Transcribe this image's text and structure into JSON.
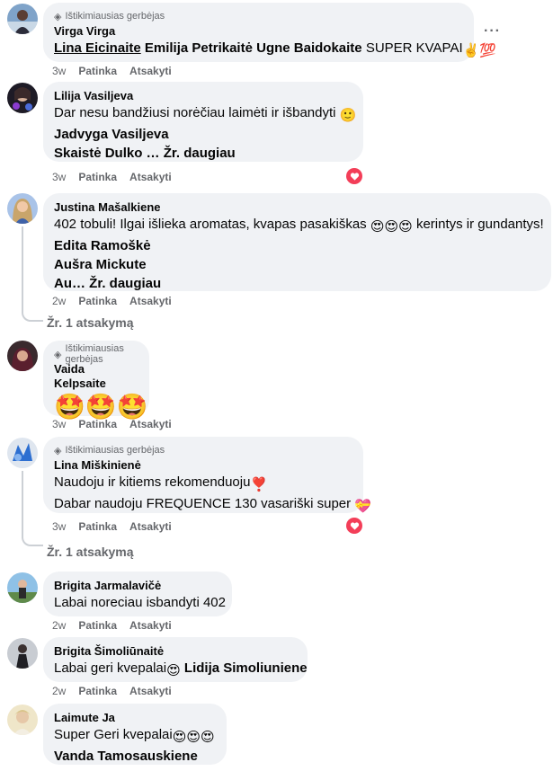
{
  "fan_badge": "Ištikimiausias gerbėjas",
  "action_like": "Patinka",
  "action_reply": "Atsakyti",
  "comments": [
    {
      "author": "Virga Virga",
      "time": "3w",
      "line1_tag1": "Lina Eicinaite",
      "line1_tag2": "Emilija Petrikaitė",
      "line1_tag3": "Ugne Baidokaite",
      "line1_text": "SUPER KVAPAI",
      "line1_emoji": "✌️💯"
    },
    {
      "author": "Lilija Vasiljeva",
      "time": "3w",
      "line1": "Dar nesu bandžiusi norėčiau laimėti ir išbandyti",
      "line1_emoji": "🙂",
      "line2_tag": "Jadvyga Vasiljeva",
      "line3_tag": "Skaistė Dulko",
      "line3_more": "… Žr. daugiau"
    },
    {
      "author": "Justina Mašalkiene",
      "time": "2w",
      "line1": "402 tobuli! Ilgai išlieka aromatas, kvapas pasakiškas",
      "line1_emoji": "😍😍😍",
      "line1_tail": "kerintys ir gundantys!",
      "line2_tag": "Edita Ramoškė",
      "line3_tag": "Aušra Mickute",
      "line4_tag": "Au",
      "line4_more": "… Žr. daugiau",
      "replies": "Žr. 1 atsakymą"
    },
    {
      "author": "Vaida Kelpsaite",
      "time": "3w",
      "emoji_line": "🤩🤩🤩"
    },
    {
      "author": "Lina Miškinienė",
      "time": "3w",
      "line1": "Naudoju ir kitiems rekomenduoju",
      "line1_emoji": "❣️",
      "line2": "Dabar naudoju FREQUENCE 130 vasariški super",
      "line2_emoji": "💝",
      "replies": "Žr. 1 atsakymą"
    },
    {
      "author": "Brigita Jarmalavičė",
      "time": "2w",
      "line1": "Labai noreciau isbandyti 402"
    },
    {
      "author": "Brigita Šimoliūnaitė",
      "time": "2w",
      "line1": "Labai geri kvepalai",
      "line1_emoji": "😍",
      "line1_tag": "Lidija Simoliuniene"
    },
    {
      "author": "Laimute Ja",
      "line1": "Super Geri kvepalai",
      "line1_emoji": "😍😍😍",
      "line2_tag": "Vanda Tamosauskiene"
    }
  ],
  "colors": {
    "bubble": "#f0f2f5",
    "muted": "#65676b",
    "love": "#f33e58"
  }
}
